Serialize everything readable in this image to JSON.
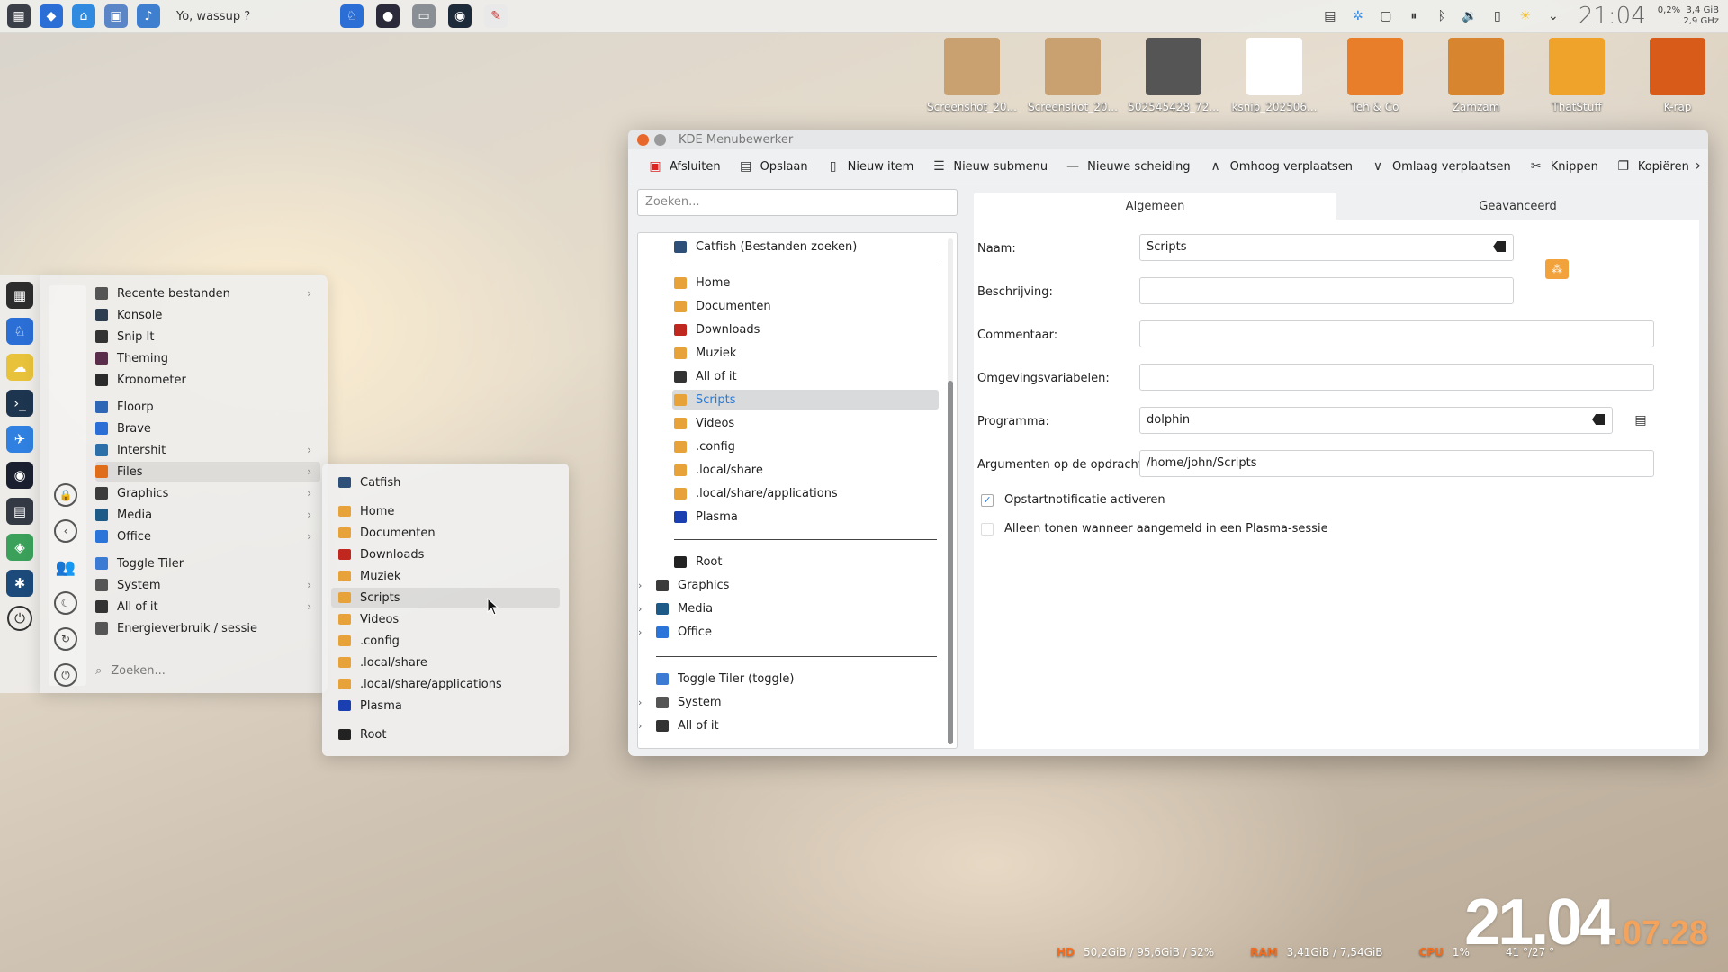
{
  "top_panel": {
    "title": "Yo, wassup ?",
    "clock": "21:04",
    "sys_cpu": "0,2%",
    "sys_freq": "2,9 GHz",
    "sys_mem": "3,4 GiB",
    "left_icons": [
      "overview-icon",
      "files-icon",
      "home-folder-icon",
      "grid-icon",
      "music-icon"
    ],
    "mid_icons": [
      "brave-icon",
      "obs-icon",
      "window-icon",
      "eye-icon",
      "tools-icon"
    ],
    "tray_icons": [
      "notes-icon",
      "kde-connect-icon",
      "clipboard-icon",
      "pause-icon",
      "bluetooth-icon",
      "volume-icon",
      "battery-icon",
      "weather-icon",
      "chevron-down-icon"
    ]
  },
  "desktop": {
    "icons": [
      {
        "label": "Screenshot_20...",
        "color": "#c9a070"
      },
      {
        "label": "Screenshot_20...",
        "color": "#c9a070"
      },
      {
        "label": "502545428_72...",
        "color": "#555555"
      },
      {
        "label": "ksnip_202506...",
        "color": "#ffffff"
      },
      {
        "label": "Teh & Co",
        "color": "#e87d2a"
      },
      {
        "label": "Zamzam",
        "color": "#d7862f"
      },
      {
        "label": "ThatStuff",
        "color": "#f0a32a"
      },
      {
        "label": "K-rap",
        "color": "#d95b1a"
      }
    ]
  },
  "launcher": {
    "items": [
      {
        "label": "Recente bestanden",
        "has_sub": true,
        "color": "#555555"
      },
      {
        "label": "Konsole",
        "has_sub": false,
        "color": "#2d3e50"
      },
      {
        "label": "Snip It",
        "has_sub": false,
        "color": "#333333"
      },
      {
        "label": "Theming",
        "has_sub": false,
        "color": "#5a2d4a"
      },
      {
        "label": "Kronometer",
        "has_sub": false,
        "color": "#2b2b2b"
      },
      {
        "label": "Floorp",
        "has_sub": false,
        "color": "#2d67b6"
      },
      {
        "label": "Brave",
        "has_sub": false,
        "color": "#2b6fd6"
      },
      {
        "label": "Intershit",
        "has_sub": true,
        "color": "#2d6fa8"
      },
      {
        "label": "Files",
        "has_sub": true,
        "color": "#e06d1a"
      },
      {
        "label": "Graphics",
        "has_sub": true,
        "color": "#3b3b3b"
      },
      {
        "label": "Media",
        "has_sub": true,
        "color": "#1e5a88"
      },
      {
        "label": "Office",
        "has_sub": true,
        "color": "#2b74d9"
      },
      {
        "label": "Toggle Tiler",
        "has_sub": false,
        "color": "#3c7bd4"
      },
      {
        "label": "System",
        "has_sub": true,
        "color": "#555555"
      },
      {
        "label": "All of it",
        "has_sub": true,
        "color": "#333333"
      },
      {
        "label": "Energieverbruik / sessie",
        "has_sub": false,
        "color": "#555555"
      }
    ],
    "search_placeholder": "Zoeken..."
  },
  "submenu": {
    "items": [
      {
        "label": "Catfish",
        "color": "#2d4f78"
      },
      {
        "label": "Home",
        "color": "#e8a23a"
      },
      {
        "label": "Documenten",
        "color": "#e8a23a"
      },
      {
        "label": "Downloads",
        "color": "#c0271e"
      },
      {
        "label": "Muziek",
        "color": "#e8a23a"
      },
      {
        "label": "Scripts",
        "color": "#e8a23a"
      },
      {
        "label": "Videos",
        "color": "#e8a23a"
      },
      {
        "label": ".config",
        "color": "#e8a23a"
      },
      {
        "label": ".local/share",
        "color": "#e8a23a"
      },
      {
        "label": ".local/share/applications",
        "color": "#e8a23a"
      },
      {
        "label": "Plasma",
        "color": "#1a3fb0"
      },
      {
        "label": "Root",
        "color": "#222222"
      }
    ]
  },
  "window": {
    "title": "KDE Menubewerker",
    "toolbar": [
      "Afsluiten",
      "Opslaan",
      "Nieuw item",
      "Nieuw submenu",
      "Nieuwe scheiding",
      "Omhoog verplaatsen",
      "Omlaag verplaatsen",
      "Knippen",
      "Kopiëren"
    ],
    "search_placeholder": "Zoeken...",
    "tree": [
      {
        "label": "Catfish  (Bestanden zoeken)",
        "color": "#2d4f78"
      },
      {
        "label": "Home",
        "color": "#e8a23a"
      },
      {
        "label": "Documenten",
        "color": "#e8a23a"
      },
      {
        "label": "Downloads",
        "color": "#c0271e"
      },
      {
        "label": "Muziek",
        "color": "#e8a23a"
      },
      {
        "label": "All of it",
        "color": "#333333"
      },
      {
        "label": "Scripts",
        "color": "#e8a23a"
      },
      {
        "label": "Videos",
        "color": "#e8a23a"
      },
      {
        "label": ".config",
        "color": "#e8a23a"
      },
      {
        "label": ".local/share",
        "color": "#e8a23a"
      },
      {
        "label": ".local/share/applications",
        "color": "#e8a23a"
      },
      {
        "label": "Plasma",
        "color": "#1a3fb0"
      },
      {
        "label": "Root",
        "color": "#222222"
      },
      {
        "label": "Graphics",
        "color": "#3b3b3b"
      },
      {
        "label": "Media",
        "color": "#1e5a88"
      },
      {
        "label": "Office",
        "color": "#2b74d9"
      },
      {
        "label": "Toggle Tiler (toggle)",
        "color": "#3c7bd4"
      },
      {
        "label": "System",
        "color": "#555555"
      },
      {
        "label": "All of it",
        "color": "#333333"
      }
    ],
    "tabs": [
      "Algemeen",
      "Geavanceerd"
    ],
    "form": {
      "naam_label": "Naam:",
      "naam_value": "Scripts",
      "beschrijving_label": "Beschrijving:",
      "beschrijving_value": "",
      "commentaar_label": "Commentaar:",
      "commentaar_value": "",
      "omgeving_label": "Omgevingsvariabelen:",
      "omgeving_value": "",
      "programma_label": "Programma:",
      "programma_value": "dolphin",
      "argumenten_label": "Argumenten op de opdrachtregel:",
      "argumenten_value": "/home/john/Scripts",
      "check1_label": "Opstartnotificatie activeren",
      "check1_checked": true,
      "check2_label": "Alleen tonen wanneer aangemeld in een Plasma-sessie",
      "check2_checked": false
    }
  },
  "stats": {
    "hd_label": "HD",
    "hd_value": "50,2GiB / 95,6GiB / 52%",
    "ram_label": "RAM",
    "ram_value": "3,41GiB / 7,54GiB",
    "cpu_label": "CPU",
    "cpu_value": "1%",
    "temp_value": "41 °/27 °"
  },
  "bigdate": {
    "main": "21.04",
    "small": ".07.28"
  }
}
